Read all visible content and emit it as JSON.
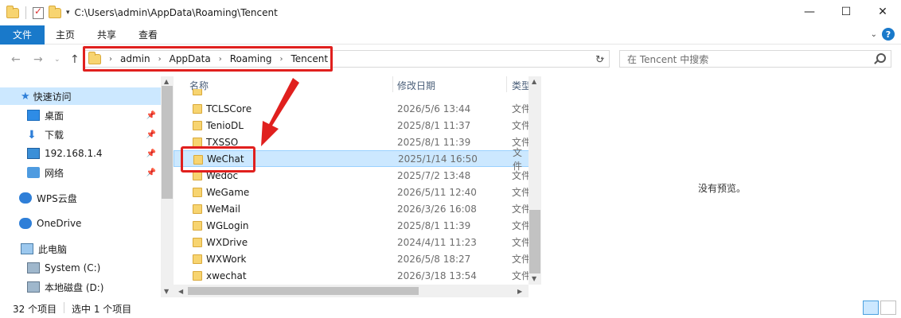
{
  "window": {
    "title_path": "C:\\Users\\admin\\AppData\\Roaming\\Tencent",
    "minimize": "—",
    "maximize": "☐",
    "close": "✕"
  },
  "ribbon": {
    "tabs": [
      "文件",
      "主页",
      "共享",
      "查看"
    ],
    "help": "?"
  },
  "address": {
    "crumbs": [
      "admin",
      "AppData",
      "Roaming",
      "Tencent"
    ],
    "search_placeholder": "在 Tencent 中搜索"
  },
  "nav": {
    "quick_access": "快速访问",
    "items": [
      {
        "label": "桌面",
        "icon": "desktop-icon"
      },
      {
        "label": "下载",
        "icon": "download-icon"
      },
      {
        "label": "192.168.1.4",
        "icon": "monitor-icon"
      },
      {
        "label": "网络",
        "icon": "network-icon"
      }
    ],
    "wps": "WPS云盘",
    "onedrive": "OneDrive",
    "this_pc": "此电脑",
    "drives": [
      "System (C:)",
      "本地磁盘 (D:)"
    ]
  },
  "columns": {
    "name": "名称",
    "date": "修改日期",
    "type": "类型"
  },
  "files": [
    {
      "name": "TCLSCore",
      "date": "2026/5/6 13:44",
      "type": "文件"
    },
    {
      "name": "TenioDL",
      "date": "2025/8/1 11:37",
      "type": "文件"
    },
    {
      "name": "TXSSO",
      "date": "2025/8/1 11:39",
      "type": "文件"
    },
    {
      "name": "WeChat",
      "date": "2025/1/14 16:50",
      "type": "文件"
    },
    {
      "name": "Wedoc",
      "date": "2025/7/2 13:48",
      "type": "文件"
    },
    {
      "name": "WeGame",
      "date": "2026/5/11 12:40",
      "type": "文件"
    },
    {
      "name": "WeMail",
      "date": "2026/3/26 16:08",
      "type": "文件"
    },
    {
      "name": "WGLogin",
      "date": "2025/8/1 11:39",
      "type": "文件"
    },
    {
      "name": "WXDrive",
      "date": "2024/4/11 11:23",
      "type": "文件"
    },
    {
      "name": "WXWork",
      "date": "2026/5/8 18:27",
      "type": "文件"
    },
    {
      "name": "xwechat",
      "date": "2026/3/18 13:54",
      "type": "文件"
    }
  ],
  "selected_index": 3,
  "preview": {
    "text": "没有预览。"
  },
  "status": {
    "count": "32 个项目",
    "selected": "选中 1 个项目"
  },
  "colors": {
    "accent": "#1979ca",
    "selection": "#cce8ff",
    "annotation": "#e0201e"
  }
}
